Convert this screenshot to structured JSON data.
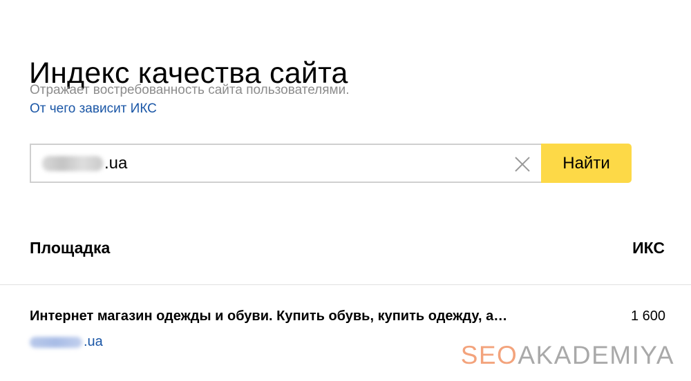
{
  "page": {
    "title": "Индекс качества сайта",
    "subtitle": "Отражает востребованность сайта пользователями.",
    "help_link": "От чего зависит ИКС"
  },
  "search": {
    "value_suffix": ".ua",
    "button_label": "Найти",
    "clear_icon": "close-icon"
  },
  "table": {
    "columns": [
      "Площадка",
      "ИКС"
    ],
    "rows": [
      {
        "title": "Интернет магазин одежды и обуви. Купить обувь, купить одежду, а…",
        "url_suffix": ".ua",
        "iks": "1 600"
      }
    ]
  },
  "watermark": {
    "part1": "SEO",
    "part2": "AKADEMIYA"
  },
  "colors": {
    "accent_button": "#fdd947",
    "link": "#1a56a6",
    "subtitle": "#8c8c8c"
  }
}
